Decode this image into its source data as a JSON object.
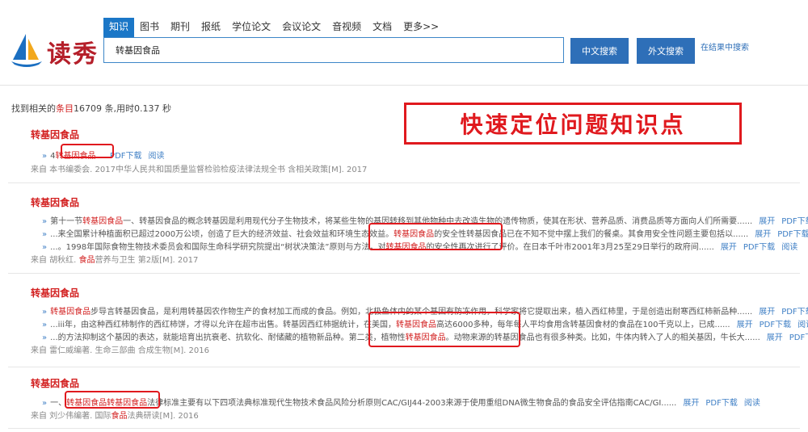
{
  "logo": {
    "text": "读秀"
  },
  "tabs": [
    "知识",
    "图书",
    "期刊",
    "报纸",
    "学位论文",
    "会议论文",
    "音视频",
    "文档",
    "更多>>"
  ],
  "search": {
    "value": "转基因食品"
  },
  "buttons": {
    "cn": "中文搜索",
    "fx": "外文搜索",
    "in_result": "在结果中搜索"
  },
  "summary": {
    "prefix": "找到相关的",
    "hl": "条目",
    "rest": "16709 条,用时0.137 秒"
  },
  "callout": "快速定位问题知识点",
  "actions": {
    "expand": "展开",
    "pdf": "PDF下载",
    "read": "阅读"
  },
  "results": [
    {
      "title": "转基因食品",
      "lines": [
        {
          "pre": "4",
          "kw": "转基因食品...",
          "post": "",
          "expand": false
        }
      ],
      "source_pre": "来自 本书编委会. 2017中华人民共和国质量监督检验检疫法律法规全书 含相关政策[M]. 2017",
      "source_kw": "",
      "source_post": ""
    },
    {
      "title": "转基因食品",
      "lines": [
        {
          "pre": "第十一节",
          "kw": "转基因食品",
          "post": "一、转基因食品的概念转基因是利用现代分子生物技术，将某些生物的基因转移到其他物种中去改造生物的遗传物质，使其在形状、营养品质、消费品质等方面向人们所需要......",
          "expand": true
        },
        {
          "pre": "...来全国累计种植面积已超过2000万公顷，创造了巨大的经济效益、社会效益和环境生态效益。",
          "kw": "转基因食品",
          "post": "的安全性转基因食品已在不知不觉中摆上我们的餐桌。其食用安全性问题主要包括以......",
          "expand": true
        },
        {
          "pre": "...。1998年国际食物生物技术委员会和国际生命科学研究院提出“树状决策法”原则与方法，对",
          "kw": "转基因食品",
          "post": "的安全性再次进行了评价。在日本千叶市2001年3月25至29日举行的政府间......",
          "expand": true
        }
      ],
      "source_pre": "来自 胡秋红. ",
      "source_kw": "食品",
      "source_post": "营养与卫生 第2版[M]. 2017"
    },
    {
      "title": "转基因食品",
      "lines": [
        {
          "pre": "",
          "kw": "转基因食品",
          "post": "步导言转基因食品，是利用转基因农作物生产的食材加工而成的食品。例如，北极鱼体内的某个基因有防冻作用，科学家将它提取出来，植入西红柿里，于是创造出耐寒西红柿新品种......",
          "expand": true
        },
        {
          "pre": "...iii年，由这种西红柿制作的西红柿饼，才得以允许在超市出售。转基因西红柿据统计，在美国，",
          "kw": "转基因食品",
          "post": "高达6000多种，每年每人平均食用含转基因食材的食品在100千克以上，已成......",
          "expand": true
        },
        {
          "pre": "...的方法抑制这个基因的表达，就能培育出抗衰老、抗软化、耐储藏的植物新品种。第二类，植物性",
          "kw": "转基因食品",
          "post": "。动物来源的转基因食品也有很多种类。比如，牛体内转入了人的相关基因，牛长大......",
          "expand": true
        }
      ],
      "source_pre": "来自 雷仁威编著. 生命三部曲 合成生物[M]. 2016",
      "source_kw": "",
      "source_post": ""
    },
    {
      "title": "转基因食品",
      "lines": [
        {
          "pre": "一、",
          "kw": "转基因食品转基因食品",
          "post": "法律标准主要有以下四项法典标准现代生物技术食品风险分析原则CAC/GIJ44-2003来源于使用重组DNA微生物食品的食品安全评估指南CAC/GI......",
          "expand": true
        }
      ],
      "source_pre": "来自 刘少伟编著. 国际",
      "source_kw": "食品",
      "source_post": "法典研读[M]. 2016"
    }
  ]
}
